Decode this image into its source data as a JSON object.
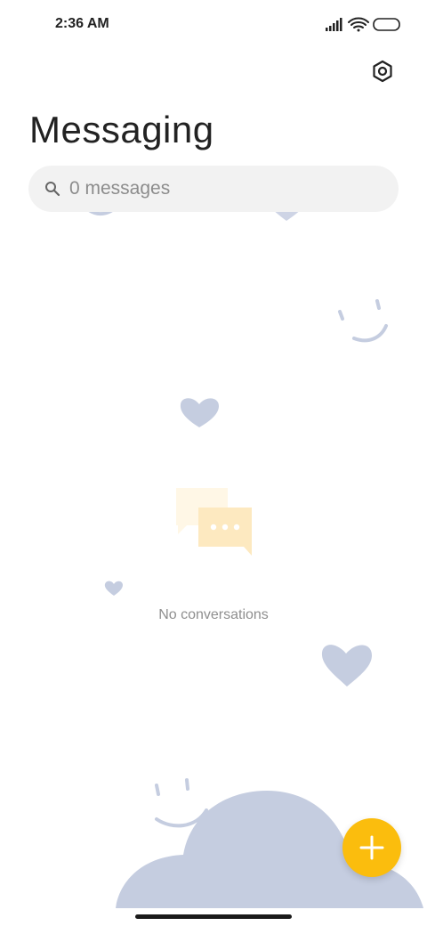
{
  "status_bar": {
    "time": "2:36 AM",
    "icons": [
      "signal-icon",
      "wifi-icon",
      "battery-icon"
    ]
  },
  "header": {
    "title": "Messaging",
    "settings_icon": "settings-icon"
  },
  "search": {
    "placeholder": "0 messages",
    "icon": "search-icon"
  },
  "empty_state": {
    "text": "No conversations",
    "icon": "chat-bubbles-icon"
  },
  "fab": {
    "icon": "plus-icon",
    "color": "#fbbd0d"
  },
  "colors": {
    "accent": "#fbbd0d",
    "decor": "#c5cde0"
  }
}
